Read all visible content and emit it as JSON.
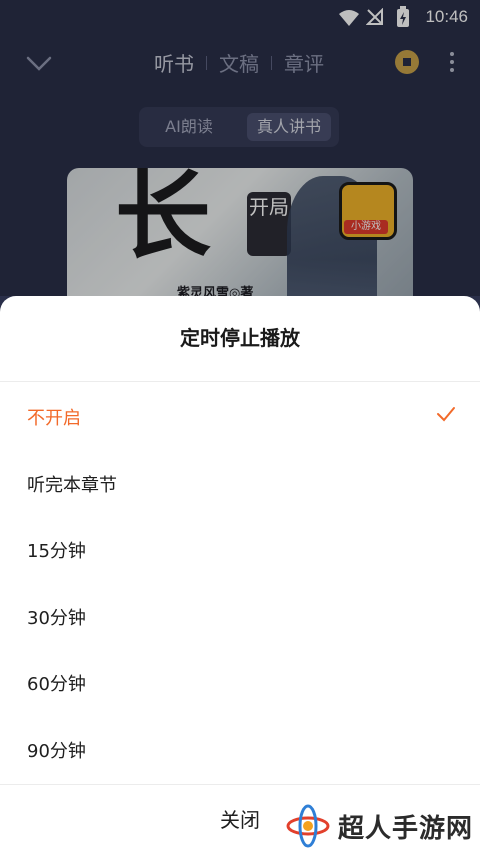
{
  "status_bar": {
    "time": "10:46"
  },
  "header": {
    "tabs": [
      {
        "label": "听书"
      },
      {
        "label": "文稿"
      },
      {
        "label": "章评"
      }
    ]
  },
  "mode_switch": {
    "ai": "AI朗读",
    "human": "真人讲书"
  },
  "cover": {
    "title_glyph": "长",
    "seal_text": "开局",
    "author": "紫灵风雪◎著",
    "badge_label": "小游戏"
  },
  "sheet": {
    "title": "定时停止播放",
    "options": [
      {
        "label": "不开启",
        "selected": true
      },
      {
        "label": "听完本章节",
        "selected": false
      },
      {
        "label": "15分钟",
        "selected": false
      },
      {
        "label": "30分钟",
        "selected": false
      },
      {
        "label": "60分钟",
        "selected": false
      },
      {
        "label": "90分钟",
        "selected": false
      }
    ],
    "close_label": "关闭"
  },
  "watermark": {
    "text": "超人手游网"
  },
  "colors": {
    "accent": "#f26a2a",
    "backdrop": "#2a2f49"
  }
}
